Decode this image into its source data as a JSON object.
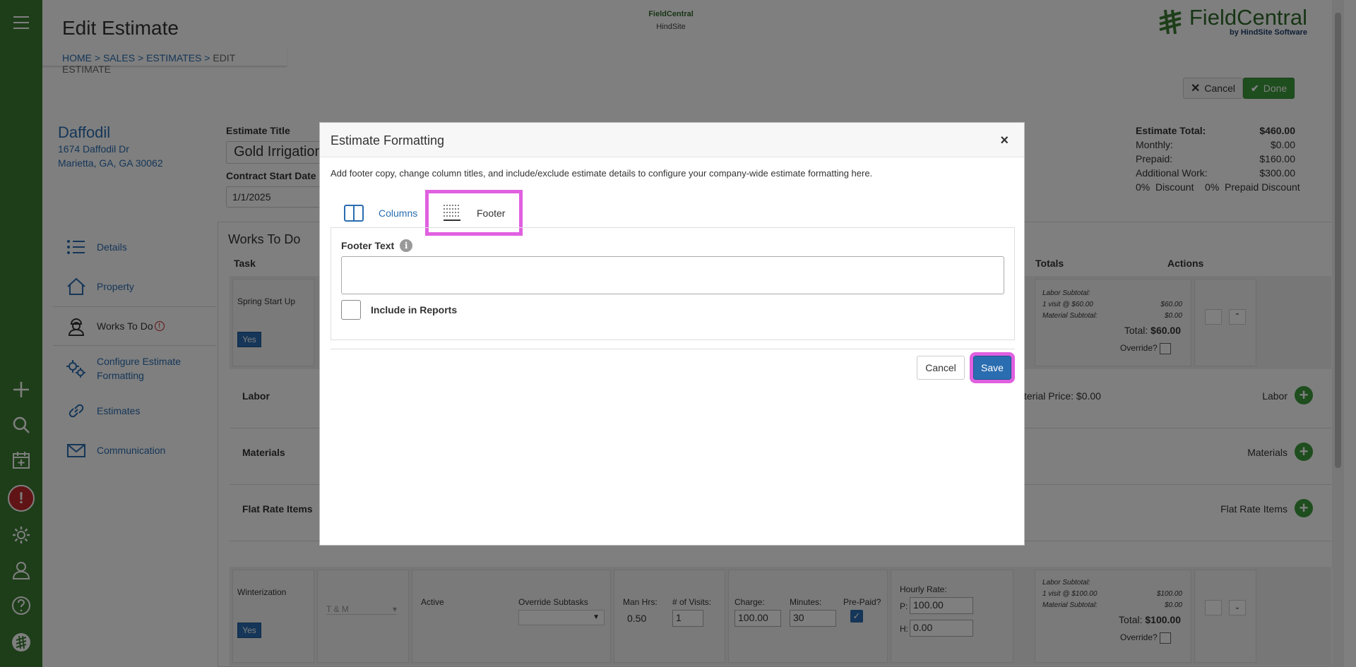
{
  "header": {
    "page_title": "Edit Estimate",
    "breadcrumb": {
      "home": "HOME",
      "sales": "SALES",
      "estimates": "ESTIMATES",
      "current": "EDIT ESTIMATE",
      "sep": " > "
    },
    "center_logo": {
      "line1": "FieldCentral",
      "line2": "HindSite"
    },
    "brand": {
      "name": "FieldCentral",
      "by": "by HindSite Software"
    },
    "cancel_label": "Cancel",
    "done_label": "Done"
  },
  "customer": {
    "name": "Daffodil",
    "address1": "1674 Daffodil Dr",
    "address2": "Marietta, GA, GA 30062"
  },
  "estimate": {
    "title_label": "Estimate Title",
    "title_value": "Gold Irrigation",
    "start_label": "Contract Start Date",
    "start_value": "1/1/2025"
  },
  "totals": {
    "total_label": "Estimate Total:",
    "total_value": "$460.00",
    "monthly_label": "Monthly:",
    "monthly_value": "$0.00",
    "prepaid_label": "Prepaid:",
    "prepaid_value": "$160.00",
    "additional_label": "Additional Work:",
    "additional_value": "$300.00",
    "discount_line": "0%  Discount    0%  Prepaid Discount"
  },
  "nav": [
    {
      "label": "Details"
    },
    {
      "label": "Property"
    },
    {
      "label": "Works To Do"
    },
    {
      "label": "Configure Estimate Formatting"
    },
    {
      "label": "Estimates"
    },
    {
      "label": "Communication"
    }
  ],
  "works": {
    "title": "Works To Do",
    "col_task": "Task",
    "col_totals": "Totals",
    "col_actions": "Actions",
    "task1": {
      "name": "Spring Start Up",
      "toggle": "Yes",
      "labor_subtotal": "Labor Subtotal:",
      "visit_line": "1 visit @ $60.00",
      "visit_value": "$60.00",
      "material_subtotal": "Material Subtotal:",
      "material_value": "$0.00",
      "total_label": "Total:",
      "total_value": "$60.00",
      "override": "Override?"
    },
    "labor_label": "Labor",
    "labor_right": "Labor",
    "material_price": "terial Price: $0.00",
    "materials_label": "Materials",
    "materials_right": "Materials",
    "flat_label": "Flat Rate Items",
    "flat_right": "Flat Rate Items",
    "task2": {
      "name": "Winterization",
      "toggle": "Yes",
      "type": "T & M",
      "status": "Active",
      "override_subtasks": "Override Subtasks",
      "man_hrs_label": "Man Hrs:",
      "man_hrs": "0.50",
      "visits_label": "# of Visits:",
      "visits": "1",
      "charge_label": "Charge:",
      "charge": "100.00",
      "minutes_label": "Minutes:",
      "minutes": "30",
      "prepaid_label": "Pre-Paid?",
      "hourly_label": "Hourly Rate:",
      "p_label": "P:",
      "p_value": "100.00",
      "h_label": "H:",
      "h_value": "0.00",
      "labor_subtotal": "Labor Subtotal:",
      "visit_line": "1 visit @ $100.00",
      "visit_value": "$100.00",
      "material_subtotal": "Material Subtotal:",
      "material_value": "$0.00",
      "total_label": "Total:",
      "total_value": "$100.00",
      "override": "Override?"
    }
  },
  "modal": {
    "title": "Estimate Formatting",
    "close": "×",
    "description": "Add footer copy, change column titles, and include/exclude estimate details to configure your company-wide estimate formatting here.",
    "tab_columns": "Columns",
    "tab_footer": "Footer",
    "footer_text_label": "Footer Text",
    "footer_text_value": "",
    "include_label": "Include in Reports",
    "cancel_label": "Cancel",
    "save_label": "Save"
  },
  "colors": {
    "sidebar": "#3a7d33",
    "link": "#2a6db0",
    "highlight": "#e060e0",
    "success": "#3c9a3c"
  }
}
